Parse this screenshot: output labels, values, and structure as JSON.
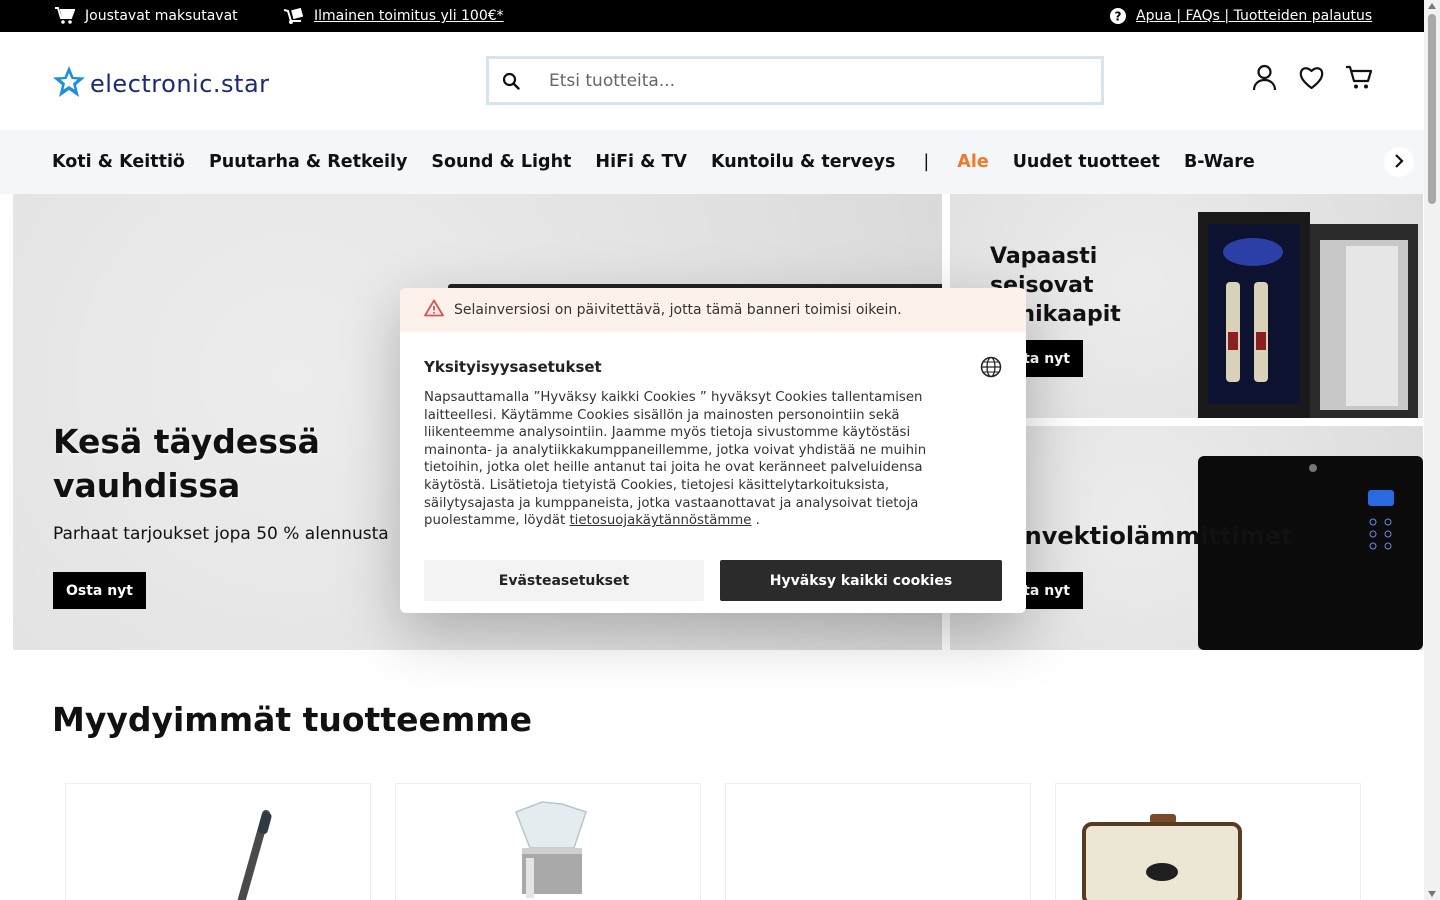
{
  "topbar": {
    "payment": "Joustavat maksutavat",
    "shipping": "Ilmainen toimitus yli 100€*",
    "help": "Apua | FAQs | Tuotteiden palautus"
  },
  "header": {
    "logo": "electronic.star",
    "search_placeholder": "Etsi tuotteita..."
  },
  "nav": {
    "items": [
      "Koti & Keittiö",
      "Puutarha & Retkeily",
      "Sound & Light",
      "HiFi & TV",
      "Kuntoilu & terveys",
      "|",
      "Ale",
      "Uudet tuotteet",
      "B-Ware"
    ]
  },
  "hero": {
    "title_line1": "Kesä täydessä",
    "title_line2": "vauhdissa",
    "subtitle": "Parhaat tarjoukset jopa 50 % alennusta",
    "cta": "Osta nyt"
  },
  "side1": {
    "title_line1": "Vapaasti",
    "title_line2": "seisovat",
    "title_line3": "viinikaapit",
    "cta": "Osta nyt"
  },
  "side2": {
    "title": "Konvektiolämmittimet",
    "cta": "Osta nyt"
  },
  "cookie": {
    "warning": "Selainversiosi on päivitettävä, jotta tämä banneri toimisi oikein.",
    "title": "Yksityisyysasetukset",
    "body": "Napsauttamalla ”Hyväksy kaikki Cookies ” hyväksyt Cookies tallentamisen laitteellesi. Käytämme Cookies sisällön ja mainosten personointiin sekä liikenteemme analysointiin. Jaamme myös tietoja sivustomme käytöstäsi mainonta- ja analytiikkakumppaneillemme, jotka voivat yhdistää ne muihin tietoihin, jotka olet heille antanut tai joita he ovat keränneet palveluidensa käytöstä. Lisätietoja tietyistä Cookies, tietojesi käsittelytarkoituksista, säilytysajasta ja kumppaneista, jotka vastaanottavat ja analysoivat tietoja puolestamme, löydät",
    "link": "tietosuojakäytännöstämme",
    "end": ".",
    "settings_button": "Evästeasetukset",
    "accept_button": "Hyväksy kaikki cookies"
  },
  "bestsellers": {
    "title": "Myydyimmät tuotteemme"
  }
}
